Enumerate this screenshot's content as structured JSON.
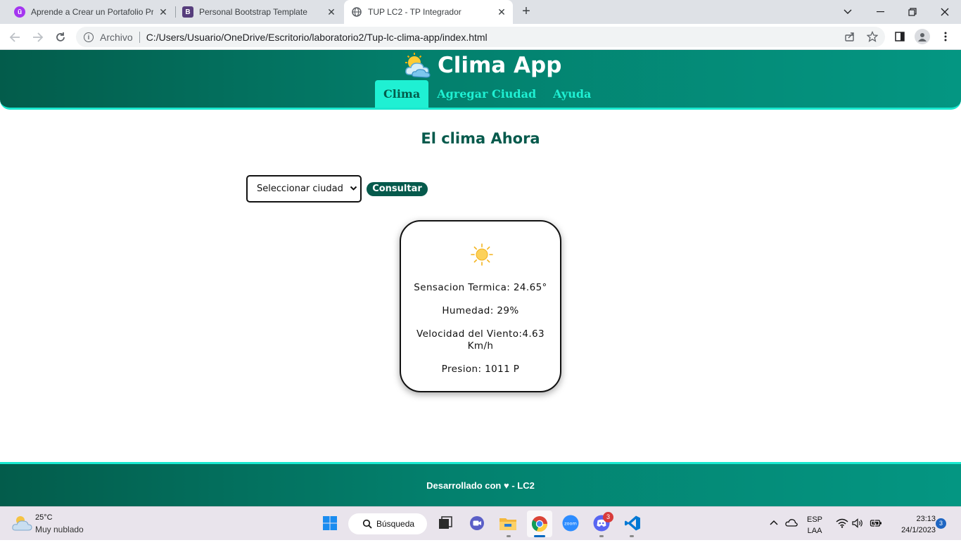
{
  "browser": {
    "tabs": [
      {
        "title": "Aprende a Crear un Portafolio Pr",
        "favicon": "udemy-icon",
        "favicon_color": "#a435f0",
        "active": false
      },
      {
        "title": "Personal Bootstrap Template",
        "favicon": "bootstrap-icon",
        "favicon_color": "#563d7c",
        "active": false
      },
      {
        "title": "TUP LC2 - TP Integrador",
        "favicon": "globe-icon",
        "favicon_color": "#5f6368",
        "active": true
      }
    ],
    "address": {
      "scheme_label": "Archivo",
      "url": "C:/Users/Usuario/OneDrive/Escritorio/laboratorio2/Tup-lc-clima-app/index.html"
    }
  },
  "app": {
    "title": "Clima App",
    "nav": [
      {
        "label": "Clima",
        "active": true
      },
      {
        "label": "Agregar Ciudad",
        "active": false
      },
      {
        "label": "Ayuda",
        "active": false
      }
    ],
    "heading": "El clima Ahora",
    "city_select": {
      "selected": "Seleccionar ciudad"
    },
    "consult_button": "Consultar",
    "weather_card": {
      "icon": "sun-icon",
      "feels_like": "Sensacion Termica: 24.65°",
      "humidity": "Humedad: 29%",
      "wind_line1": "Velocidad del Viento:4.63",
      "wind_line2": "Km/h",
      "pressure": "Presion: 1011 P"
    },
    "footer": {
      "text_before": "Desarrollado con",
      "heart": "♥",
      "text_after": "- LC2"
    },
    "colors": {
      "header_dark": "#035c4b",
      "accent": "#1ff0d3",
      "heading": "#065a4c"
    }
  },
  "taskbar": {
    "weather_temp": "25°C",
    "weather_desc": "Muy nublado",
    "search_label": "Búsqueda",
    "discord_badge": "3",
    "lang_top": "ESP",
    "lang_bottom": "LAA",
    "time": "23:13",
    "date": "24/1/2023",
    "notifications": "3"
  }
}
